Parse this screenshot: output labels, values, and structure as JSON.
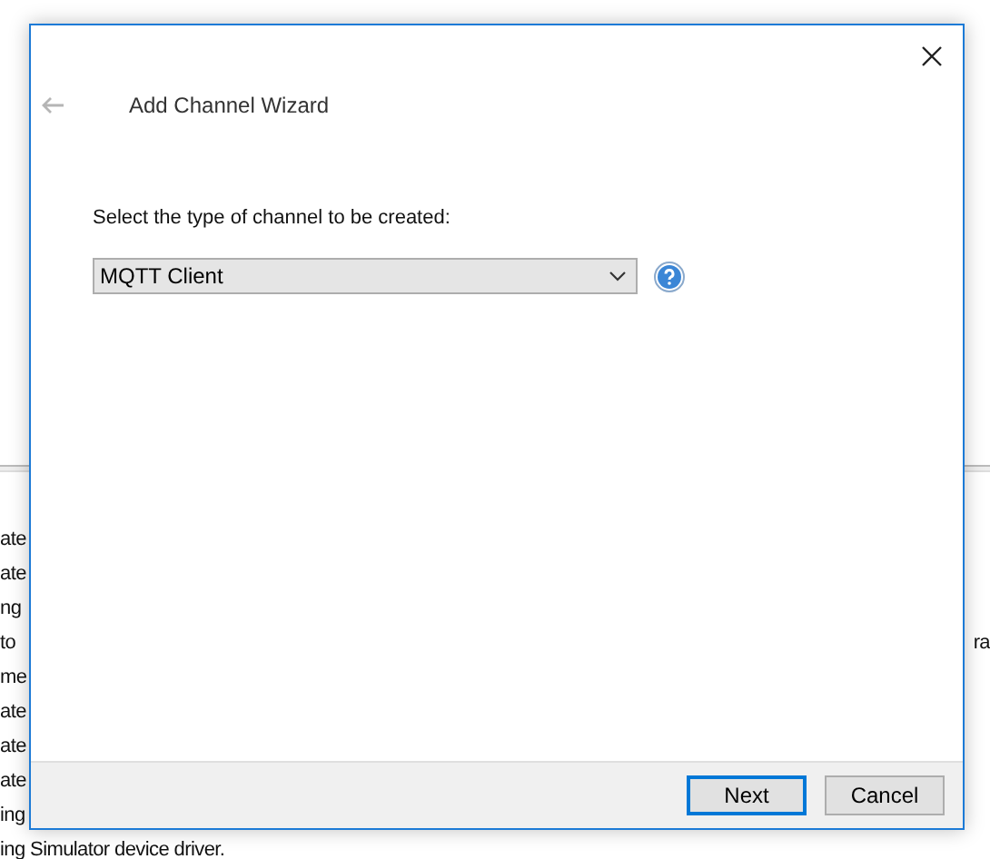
{
  "background_app": {
    "lines": [
      {
        "left": "ate"
      },
      {
        "left": "ate"
      },
      {
        "left": "ng"
      },
      {
        "left": "to",
        "right": "ra"
      },
      {
        "left": "me"
      },
      {
        "left": "ate"
      },
      {
        "left": "ate"
      },
      {
        "left": "ate"
      },
      {
        "left": "ing"
      },
      {
        "left": "ing Simulator device driver."
      }
    ]
  },
  "dialog": {
    "back": {
      "disabled": true
    },
    "title": "Add Channel Wizard",
    "prompt": "Select the type of channel to be created:",
    "channel_type": {
      "value": "MQTT Client"
    },
    "buttons": [
      {
        "label": "Next",
        "default": true
      },
      {
        "label": "Cancel",
        "default": false
      }
    ]
  }
}
